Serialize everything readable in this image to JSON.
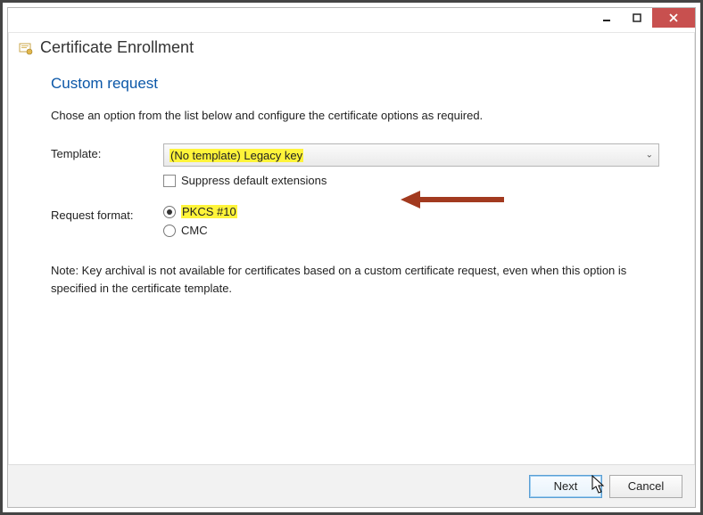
{
  "header": {
    "title": "Certificate Enrollment"
  },
  "section": {
    "title": "Custom request",
    "instruction": "Chose an option from the list below and configure the certificate options as required."
  },
  "form": {
    "template_label": "Template:",
    "template_value": "(No template) Legacy key",
    "suppress_label": "Suppress default extensions",
    "format_label": "Request format:",
    "format_options": {
      "pkcs10": "PKCS #10",
      "cmc": "CMC"
    }
  },
  "note": "Note: Key archival is not available for certificates based on a custom certificate request, even when this option is specified in the certificate template.",
  "footer": {
    "next": "Next",
    "cancel": "Cancel"
  }
}
